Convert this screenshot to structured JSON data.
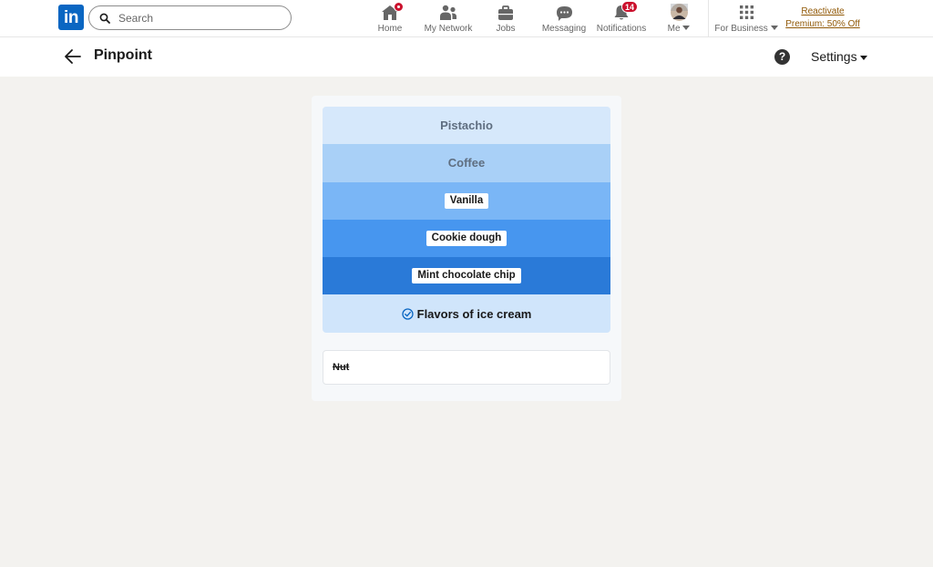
{
  "nav": {
    "search_placeholder": "Search",
    "items": [
      {
        "label": "Home",
        "icon": "home-icon"
      },
      {
        "label": "My Network",
        "icon": "network-icon"
      },
      {
        "label": "Jobs",
        "icon": "briefcase-icon"
      },
      {
        "label": "Messaging",
        "icon": "messaging-icon"
      },
      {
        "label": "Notifications",
        "icon": "bell-icon",
        "badge": "14"
      },
      {
        "label": "Me",
        "icon": "avatar"
      }
    ],
    "business_label": "For Business",
    "premium_line1": "Reactivate",
    "premium_line2": "Premium: 50% Off"
  },
  "header": {
    "title": "Pinpoint",
    "settings_label": "Settings",
    "help_glyph": "?"
  },
  "game": {
    "clues": [
      {
        "text": "Pistachio",
        "style": "plain",
        "color": "#d6e8fb"
      },
      {
        "text": "Coffee",
        "style": "plain",
        "color": "#a9d0f7"
      },
      {
        "text": "Vanilla",
        "style": "chip",
        "color": "#7ab6f6"
      },
      {
        "text": "Cookie dough",
        "style": "chip",
        "color": "#4796ef"
      },
      {
        "text": "Mint chocolate chip",
        "style": "chip",
        "color": "#2a7ad8"
      }
    ],
    "answer": "Flavors of ice cream",
    "wrong_guess": "Nut"
  },
  "colors": {
    "brand": "#0a66c2",
    "badge": "#cb112d",
    "premium": "#915907",
    "answer_bg": "#d0e5fb"
  }
}
